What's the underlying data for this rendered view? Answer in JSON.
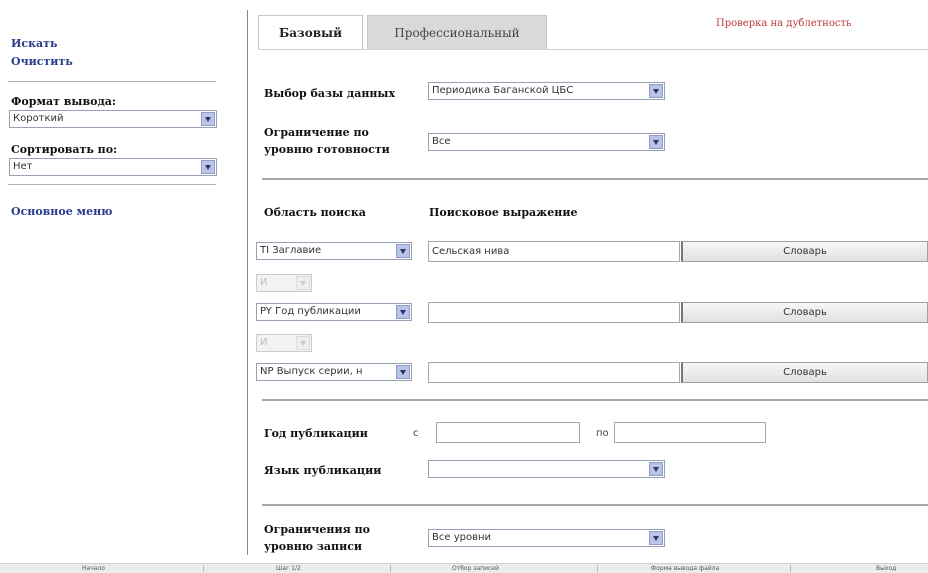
{
  "sidebar": {
    "search_link": "Искать",
    "clear_link": "Очистить",
    "output_format_label": "Формат вывода:",
    "output_format_value": "Короткий",
    "sort_label": "Сортировать по:",
    "sort_value": "Нет",
    "main_menu_link": "Основное меню"
  },
  "tabs": {
    "basic": "Базовый",
    "professional": "Профессиональный"
  },
  "duplicate_check_link": "Проверка на дублетность",
  "form": {
    "database_label": "Выбор базы данных",
    "database_value": "Периодика Баганской ЦБС",
    "readiness_label_line1": "Ограничение по",
    "readiness_label_line2": "уровню готовности",
    "readiness_value": "Все",
    "search_area_header": "Область поиска",
    "search_expr_header": "Поисковое выражение",
    "rows": [
      {
        "field": "TI Заглавие",
        "value": "Сельская нива",
        "button": "Словарь"
      },
      {
        "field": "PY Год публикации",
        "value": "",
        "button": "Словарь"
      },
      {
        "field": "NP Выпуск серии, н",
        "value": "",
        "button": "Словарь"
      }
    ],
    "logic_ops": [
      "И",
      "И"
    ],
    "year_label": "Год публикации",
    "year_from_label": "с",
    "year_from_value": "",
    "year_to_label": "по",
    "year_to_value": "",
    "language_label": "Язык публикации",
    "language_value": "",
    "record_level_label_line1": "Ограничения по",
    "record_level_label_line2": "уровню записи",
    "record_level_value": "Все уровни"
  },
  "footer": [
    "Начало",
    "Шаг 1/2",
    "Отбор записей",
    "Форма вывода файла",
    "Выход"
  ]
}
